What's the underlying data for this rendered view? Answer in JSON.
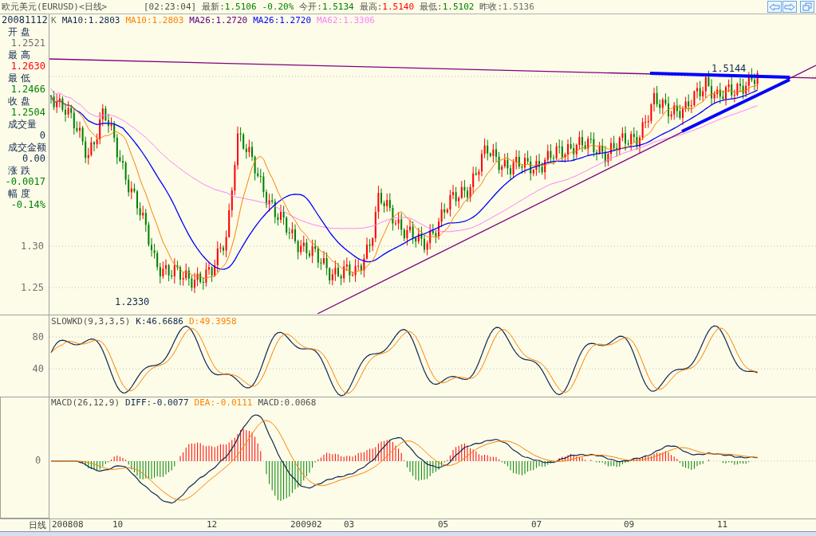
{
  "window": {
    "title": "欧元美元(EURUSD)<日线>"
  },
  "quote": {
    "time": "[02:23:04]",
    "items": [
      {
        "label": "最新:",
        "value": "1.5106",
        "color": "#008000"
      },
      {
        "value": "-0.20%",
        "color": "#008000"
      },
      {
        "label": "今开:",
        "value": "1.5134",
        "color": "#008000"
      },
      {
        "label": "最高:",
        "value": "1.5140",
        "color": "#ff0000"
      },
      {
        "label": "最低:",
        "value": "1.5102",
        "color": "#008000"
      },
      {
        "label": "昨收:",
        "value": "1.5136",
        "color": "#707070"
      }
    ]
  },
  "info_panel": {
    "date": "20081112",
    "fields": [
      {
        "label": "开 盘",
        "value": "1.2521",
        "color": "#707070"
      },
      {
        "label": "最 高",
        "value": "1.2630",
        "color": "#ff0000"
      },
      {
        "label": "最 低",
        "value": "1.2466",
        "color": "#008000"
      },
      {
        "label": "收 盘",
        "value": "1.2504",
        "color": "#008000"
      },
      {
        "label": "成交量",
        "value": "0",
        "color": "#102850"
      },
      {
        "label": "成交金额",
        "value": "0.00",
        "color": "#102850"
      },
      {
        "label": "涨 跌",
        "value": "-0.0017",
        "color": "#008000"
      },
      {
        "label": "幅 度",
        "value": "-0.14%",
        "color": "#008000"
      }
    ]
  },
  "main_chart": {
    "legend": [
      {
        "text": "K",
        "color": "#707070"
      },
      {
        "text": "MA10:1.2803",
        "color": "#102850"
      },
      {
        "text": "MA10:1.2803",
        "color": "#ff8000"
      },
      {
        "text": "MA26:1.2720",
        "color": "#600080"
      },
      {
        "text": "MA26:1.2720",
        "color": "#0000ff"
      },
      {
        "text": "MA62:1.3306",
        "color": "#ff80ff"
      }
    ],
    "y_ticks": [
      "1.30",
      "1.25"
    ],
    "high_label": "1.5144",
    "low_label": "1.2330"
  },
  "kd_chart": {
    "name": "SLOWKD(9,3,3,5)",
    "k": "K:46.6686",
    "d": "D:49.3958",
    "y_ticks": [
      "80",
      "40"
    ]
  },
  "macd_chart": {
    "name": "MACD(26,12,9)",
    "diff": "DIFF:-0.0077",
    "dea": "DEA:-0.0111",
    "macd": "MACD:0.0068",
    "y_ticks": [
      "0"
    ]
  },
  "time_axis": {
    "period": "日线",
    "labels": [
      "200808",
      "10",
      "12",
      "200902",
      "03",
      "05",
      "07",
      "09",
      "11"
    ]
  }
}
